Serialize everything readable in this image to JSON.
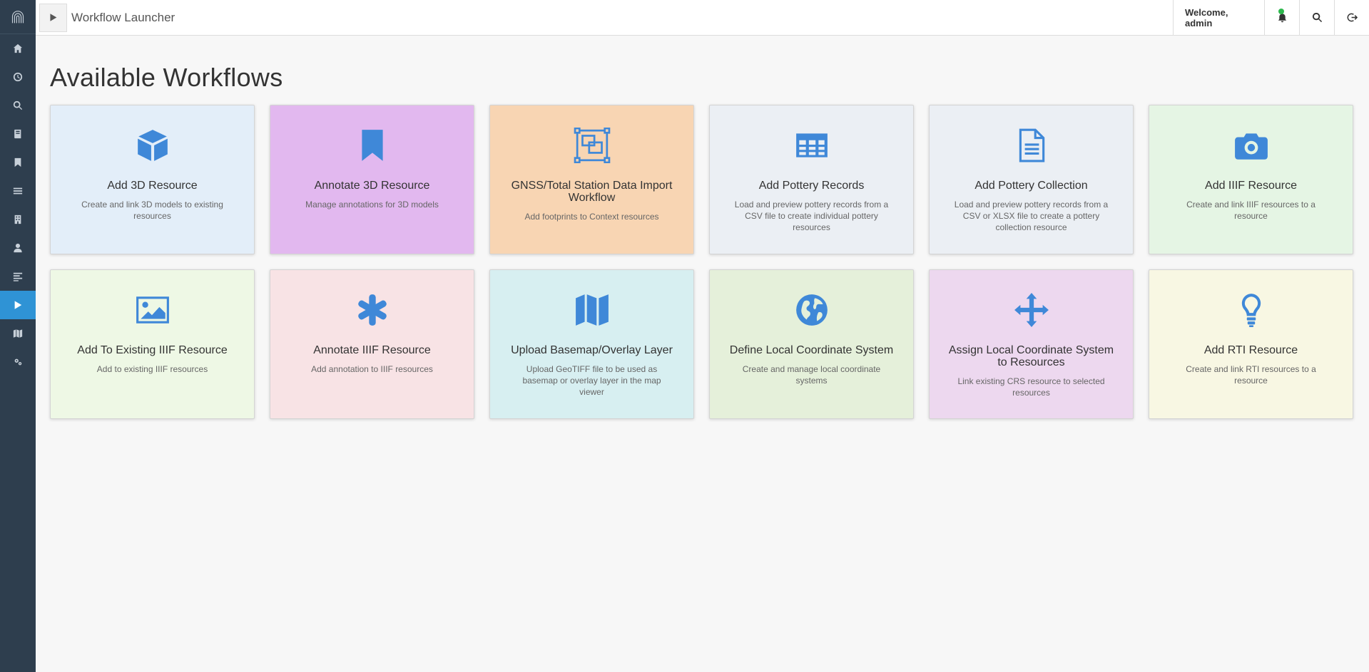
{
  "header": {
    "title": "Workflow Launcher",
    "welcome": "Welcome, admin"
  },
  "sidebar": {
    "items": [
      {
        "icon": "home-icon"
      },
      {
        "icon": "clock-icon"
      },
      {
        "icon": "search-icon"
      },
      {
        "icon": "book-icon"
      },
      {
        "icon": "bookmark-icon"
      },
      {
        "icon": "list-icon"
      },
      {
        "icon": "building-icon"
      },
      {
        "icon": "user-icon"
      },
      {
        "icon": "align-left-icon"
      },
      {
        "icon": "play-icon",
        "active": true
      },
      {
        "icon": "map-icon"
      },
      {
        "icon": "cogs-icon"
      }
    ]
  },
  "main": {
    "heading": "Available Workflows",
    "cards": [
      {
        "title": "Add 3D Resource",
        "desc": "Create and link 3D models to existing resources",
        "color": "#e3eef9",
        "icon": "cube-icon"
      },
      {
        "title": "Annotate 3D Resource",
        "desc": "Manage annotations for 3D models",
        "color": "#e2b8ef",
        "icon": "bookmark-icon"
      },
      {
        "title": "GNSS/Total Station Data Import Workflow",
        "desc": "Add footprints to Context resources",
        "color": "#f8d5b3",
        "icon": "object-group-icon"
      },
      {
        "title": "Add Pottery Records",
        "desc": "Load and preview pottery records from a CSV file to create individual pottery resources",
        "color": "#ebeff4",
        "icon": "table-icon"
      },
      {
        "title": "Add Pottery Collection",
        "desc": "Load and preview pottery records from a CSV or XLSX file to create a pottery collection resource",
        "color": "#ebeff4",
        "icon": "file-text-icon"
      },
      {
        "title": "Add IIIF Resource",
        "desc": "Create and link IIIF resources to a resource",
        "color": "#e5f5e4",
        "icon": "camera-icon"
      },
      {
        "title": "Add To Existing IIIF Resource",
        "desc": "Add to existing IIIF resources",
        "color": "#eef8e5",
        "icon": "image-icon"
      },
      {
        "title": "Annotate IIIF Resource",
        "desc": "Add annotation to IIIF resources",
        "color": "#f8e3e5",
        "icon": "asterisk-icon"
      },
      {
        "title": "Upload Basemap/Overlay Layer",
        "desc": "Upload GeoTIFF file to be used as basemap or overlay layer in the map viewer",
        "color": "#d7eff1",
        "icon": "map-icon"
      },
      {
        "title": "Define Local Coordinate System",
        "desc": "Create and manage local coordinate systems",
        "color": "#e5f0da",
        "icon": "globe-icon"
      },
      {
        "title": "Assign Local Coordinate System to Resources",
        "desc": "Link existing CRS resource to selected resources",
        "color": "#edd8ef",
        "icon": "arrows-icon"
      },
      {
        "title": "Add RTI Resource",
        "desc": "Create and link RTI resources to a resource",
        "color": "#f8f7e3",
        "icon": "lightbulb-icon"
      }
    ]
  }
}
